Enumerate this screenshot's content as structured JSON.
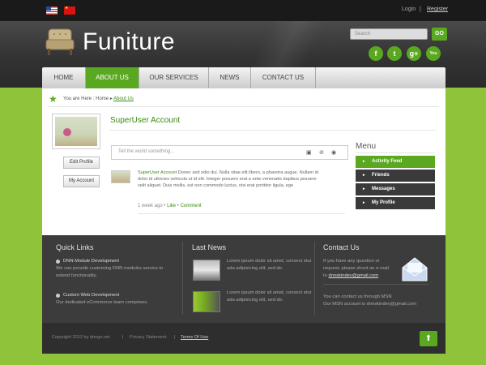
{
  "top": {
    "login": "Login",
    "separator": "|",
    "register": "Register"
  },
  "brand": {
    "name": "Funiture"
  },
  "search": {
    "placeholder": "Search",
    "go": "GO"
  },
  "social": [
    {
      "name": "facebook-icon",
      "glyph": "f"
    },
    {
      "name": "twitter-icon",
      "glyph": "t"
    },
    {
      "name": "google-plus-icon",
      "glyph": "g+"
    },
    {
      "name": "youtube-icon",
      "glyph": "You"
    }
  ],
  "nav": [
    "HOME",
    "ABOUT US",
    "OUR SERVICES",
    "NEWS",
    "CONTACT US"
  ],
  "breadcrumb": {
    "prefix": "You are Here : Home",
    "link": "About Us"
  },
  "profile": {
    "edit": "Edit Profile",
    "account": "My Account"
  },
  "page_title": "SuperUser Account",
  "post": {
    "placeholder": "Tell the world something..."
  },
  "feed": {
    "user": "SuperUser Account",
    "text": "Donec sed odio dui. Nulla vitae elit libero, a pharetra augue. Nullam id dolor id ultricies vehicula ut id elit. Integer posuere erat a ante venenatis dapibus posuere velit aliquet. Duis mollis, est non commodo luctus, nisi erat porttitor ligula, ege",
    "time": "1 week ago",
    "like": "Like",
    "comment": "Comment"
  },
  "menu": {
    "title": "Menu",
    "items": [
      "Activity Feed",
      "Friends",
      "Messages",
      "My Profile"
    ]
  },
  "footer": {
    "quick_title": "Quick Links",
    "quick": [
      {
        "title": "DNN Module Development",
        "text": "We can provide customing DNN modules service to extend functionality."
      },
      {
        "title": "Custom Web Development",
        "text": "Our dedicated eCommerce team comprises."
      }
    ],
    "news_title": "Last News",
    "news": [
      "Lorem ipsum dolor sit amet, consect etur ada adipisicing elit, sed do.",
      "Lorem ipsum dolor sit amet, consect etur ada adipisicing elit, sed do."
    ],
    "contact_title": "Contact Us",
    "contact_lines": [
      "If you have any question or",
      "request, please shoot an e-mail",
      "to"
    ],
    "email": "dnnskindev@gmail.com",
    "msn_line1": "You can contact us through MSN",
    "msn_line2": "Our MSN account is dnnskindev@gmail.com"
  },
  "bottom": {
    "copyright": "Copyright 2012 by dnngo.net",
    "sep": "|",
    "privacy": "Privacy Statement",
    "terms": "Terms Of Use"
  },
  "colors": {
    "accent": "#5aa820",
    "background_green": "#8fc43a"
  }
}
